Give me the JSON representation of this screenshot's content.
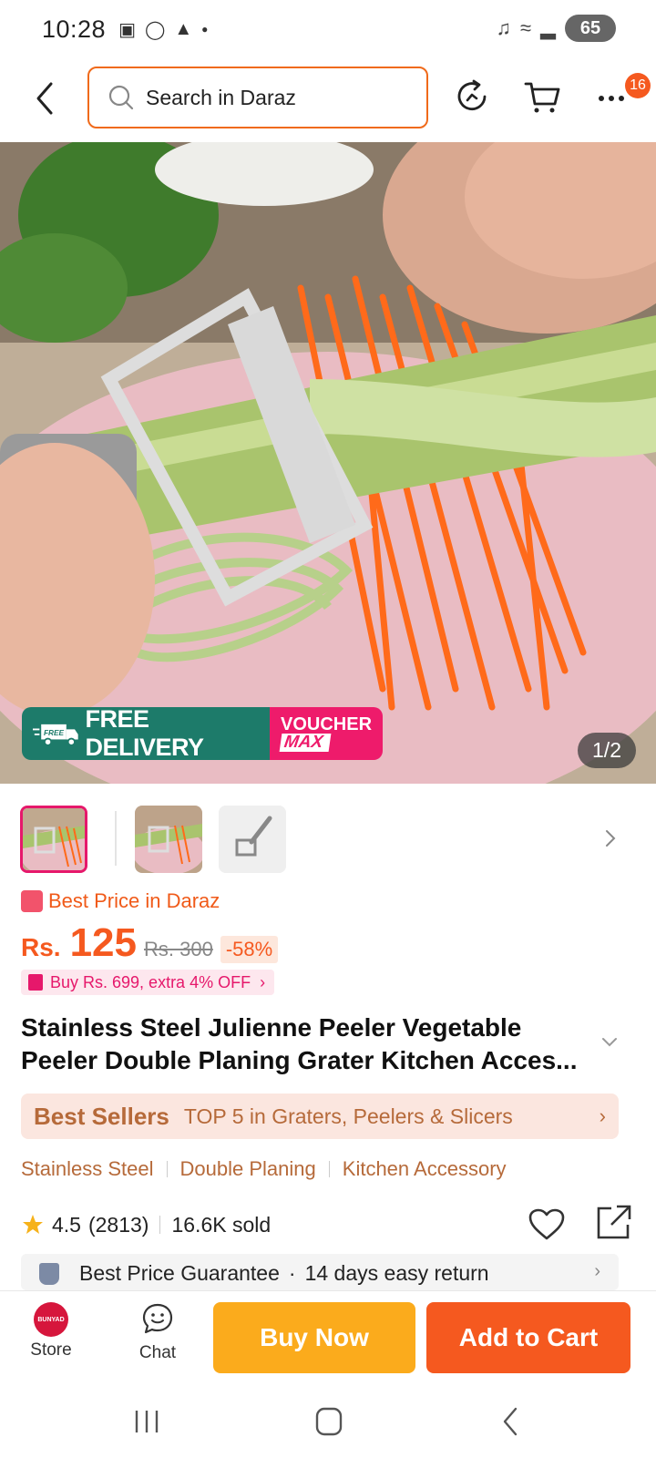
{
  "status_bar": {
    "time": "10:28",
    "battery": "65",
    "icons": [
      "screenshot-icon",
      "instagram-icon",
      "snapchat-icon",
      "dot-icon",
      "mute-icon",
      "wifi-icon",
      "signal-icon"
    ]
  },
  "header": {
    "search_placeholder": "Search in Daraz",
    "more_badge": "16"
  },
  "hero": {
    "pager": "1/2",
    "free_delivery_tag": "FREE",
    "free_delivery": "FREE DELIVERY",
    "voucher_line1": "VOUCHER",
    "voucher_line2": "MAX"
  },
  "product": {
    "best_price_label": "Best Price in Daraz",
    "currency": "Rs.",
    "price": "125",
    "old_price": "Rs. 300",
    "discount": "-58%",
    "voucher_offer": "Buy Rs. 699, extra 4% OFF",
    "title": "Stainless Steel Julienne Peeler Vegetable Peeler Double Planing Grater Kitchen Acces...",
    "best_sellers_brand": "Best Sellers",
    "best_sellers_text": "TOP 5 in Graters, Peelers & Slicers",
    "tags": [
      "Stainless Steel",
      "Double Planing",
      "Kitchen Accessory"
    ],
    "rating": "4.5",
    "rating_count": "(2813)",
    "sold": "16.6K sold",
    "guarantee_1": "Best Price Guarantee",
    "guarantee_2": "14 days easy return"
  },
  "bottom_bar": {
    "store_logo_text": "BUNYAD",
    "store_label": "Store",
    "chat_label": "Chat",
    "buy_now": "Buy Now",
    "add_to_cart": "Add to Cart"
  },
  "colors": {
    "accent": "#f5591f",
    "buy_now": "#fbab1c",
    "voucher_pink": "#ee1b6b",
    "delivery_green": "#1d7b6a",
    "best_sellers_brown": "#b66a3a"
  }
}
